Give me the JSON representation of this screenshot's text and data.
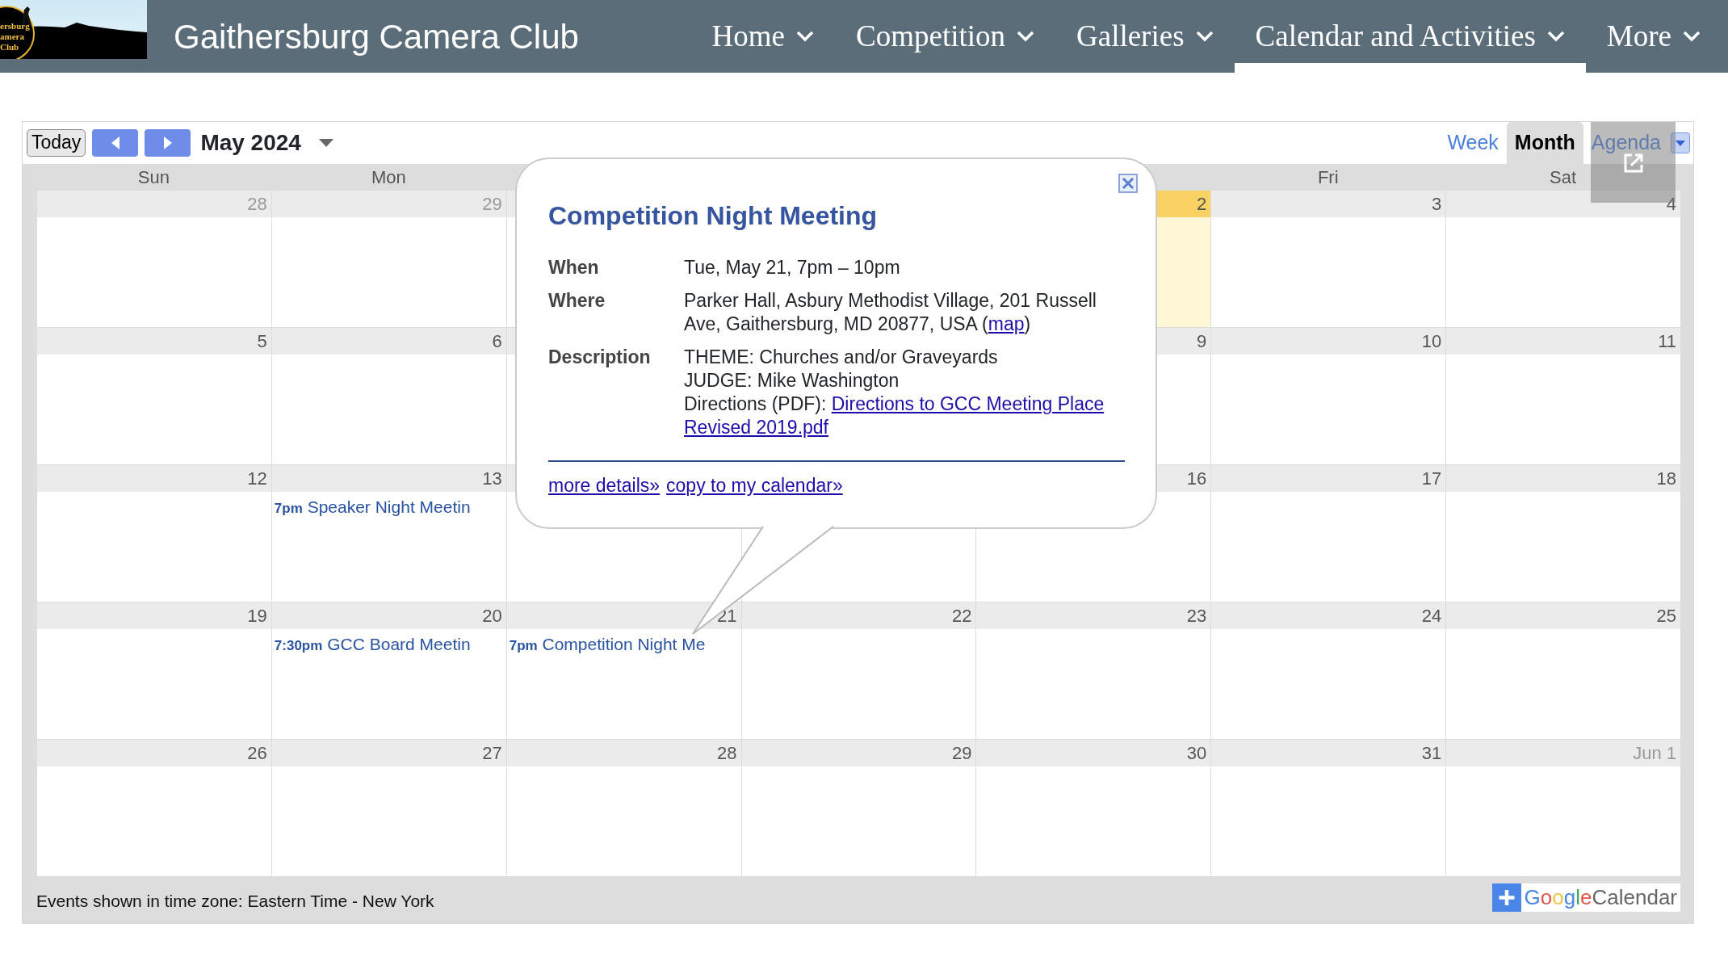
{
  "header": {
    "logo": {
      "lines": [
        "ersburg",
        "amera",
        "Club"
      ]
    },
    "title": "Gaithersburg Camera Club",
    "nav": [
      {
        "label": "Home",
        "selected": false
      },
      {
        "label": "Competition",
        "selected": false
      },
      {
        "label": "Galleries",
        "selected": false
      },
      {
        "label": "Calendar and Activities",
        "selected": true
      },
      {
        "label": "More",
        "selected": false
      }
    ]
  },
  "calendar": {
    "today_button": "Today",
    "month_title": "May 2024",
    "views": [
      {
        "label": "Week",
        "selected": false
      },
      {
        "label": "Month",
        "selected": true
      },
      {
        "label": "Agenda",
        "selected": false
      }
    ],
    "weekdays": {
      "sun": "Sun",
      "mon": "Mon",
      "fri": "Fri",
      "sat": "Sat"
    },
    "weeks": [
      {
        "days": {
          "sun": {
            "date": "28",
            "other_month": true,
            "today": false
          },
          "mon": {
            "date": "29",
            "other_month": true,
            "today": false
          },
          "thu": {
            "date": "2",
            "other_month": false,
            "today": true
          },
          "fri": {
            "date": "3",
            "other_month": false,
            "today": false
          },
          "sat": {
            "date": "4",
            "other_month": false,
            "today": false
          }
        }
      },
      {
        "days": {
          "sun": {
            "date": "5",
            "other_month": false,
            "today": false
          },
          "mon": {
            "date": "6",
            "other_month": false,
            "today": false
          },
          "thu": {
            "date": "9",
            "other_month": false,
            "today": false
          },
          "fri": {
            "date": "10",
            "other_month": false,
            "today": false
          },
          "sat": {
            "date": "11",
            "other_month": false,
            "today": false
          }
        }
      },
      {
        "days": {
          "sun": {
            "date": "12",
            "other_month": false,
            "today": false
          },
          "mon": {
            "date": "13",
            "other_month": false,
            "today": false,
            "events": [
              {
                "time": "7pm",
                "title": "Speaker Night Meetin"
              }
            ]
          },
          "thu": {
            "date": "16",
            "other_month": false,
            "today": false
          },
          "fri": {
            "date": "17",
            "other_month": false,
            "today": false
          },
          "sat": {
            "date": "18",
            "other_month": false,
            "today": false
          }
        }
      },
      {
        "days": {
          "sun": {
            "date": "19",
            "other_month": false,
            "today": false
          },
          "mon": {
            "date": "20",
            "other_month": false,
            "today": false,
            "events": [
              {
                "time": "7:30pm",
                "title": "GCC Board Meetin"
              }
            ]
          },
          "tue": {
            "date": "21",
            "other_month": false,
            "today": false,
            "events": [
              {
                "time": "7pm",
                "title": "Competition Night Me"
              }
            ]
          },
          "wed": {
            "date": "22",
            "other_month": false,
            "today": false
          },
          "thu": {
            "date": "23",
            "other_month": false,
            "today": false
          },
          "fri": {
            "date": "24",
            "other_month": false,
            "today": false
          },
          "sat": {
            "date": "25",
            "other_month": false,
            "today": false
          }
        }
      },
      {
        "days": {
          "sun": {
            "date": "26",
            "other_month": false,
            "today": false
          },
          "mon": {
            "date": "27",
            "other_month": false,
            "today": false
          },
          "tue": {
            "date": "28",
            "other_month": false,
            "today": false
          },
          "wed": {
            "date": "29",
            "other_month": false,
            "today": false
          },
          "thu": {
            "date": "30",
            "other_month": false,
            "today": false
          },
          "fri": {
            "date": "31",
            "other_month": false,
            "today": false
          },
          "sat": {
            "date": "Jun 1",
            "other_month": true,
            "today": false
          }
        }
      }
    ],
    "timezone": "Events shown in time zone: Eastern Time - New York",
    "badge": {
      "brand": "Google",
      "product": "Calendar"
    }
  },
  "popup": {
    "title": "Competition Night Meeting",
    "when": {
      "label": "When",
      "value": "Tue, May 21, 7pm – 10pm"
    },
    "where": {
      "label": "Where",
      "text": "Parker Hall, Asbury Methodist Village, 201 Russell Ave, Gaithersburg, MD 20877, USA (",
      "link": "map",
      "after": ")"
    },
    "description": {
      "label": "Description",
      "lines": [
        {
          "text": "THEME: Churches and/or Graveyards"
        },
        {
          "text": "JUDGE: Mike Washington"
        },
        {
          "text": "Directions (PDF):",
          "link": "Directions to GCC Meeting Place"
        },
        {
          "link": "Revised 2019.pdf"
        }
      ]
    },
    "links": [
      "more details»",
      "copy to my calendar»"
    ]
  }
}
